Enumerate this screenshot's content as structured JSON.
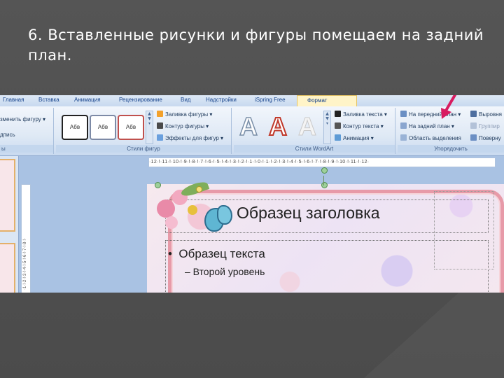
{
  "heading": "6. Вставленные рисунки и фигуры помещаем на задний план.",
  "ribbon": {
    "tabs": [
      "Главная",
      "Вставка",
      "Анимация",
      "Рецензирование",
      "Вид",
      "Надстройки",
      "iSpring Free",
      "Формат"
    ],
    "active_tab": "Формат",
    "left_cmds": [
      "зменить фигуру",
      "дпись",
      "ы"
    ],
    "shape_styles": {
      "swatches": [
        "Абв",
        "Абв",
        "Абв"
      ],
      "fill": "Заливка фигуры",
      "outline": "Контур фигуры",
      "effects": "Эффекты для фигур",
      "label": "Стили фигур"
    },
    "wordart": {
      "glyph": "A",
      "fill": "Заливка текста",
      "outline": "Контур текста",
      "animation": "Анимация",
      "label": "Стили WordArt"
    },
    "arrange": {
      "front": "На передний план",
      "back": "На задний план",
      "pane": "Область выделения",
      "align": "Выровня",
      "group": "Группир",
      "rotate": "Поверну",
      "label": "Упорядочить"
    }
  },
  "ruler": "·12·!·11·!·10·!·9·!·8·!·7·!·6·!·5·!·4·!·3·!·2·!·1·!·0·!·1·!·2·!·3·!·4·!·5·!·6·!·7·!·8·!·9·!·10·!·11·!·12·",
  "vruler": "·1·!·2·!·3·!·4·!·5·!·6·!·7·!·8·!·",
  "slide": {
    "title": "Образец заголовка",
    "bullet": "Образец текста",
    "level2": "– Второй уровень"
  },
  "colors": {
    "arrow": "#d81b60",
    "accent_tab": "#fff4c8"
  }
}
